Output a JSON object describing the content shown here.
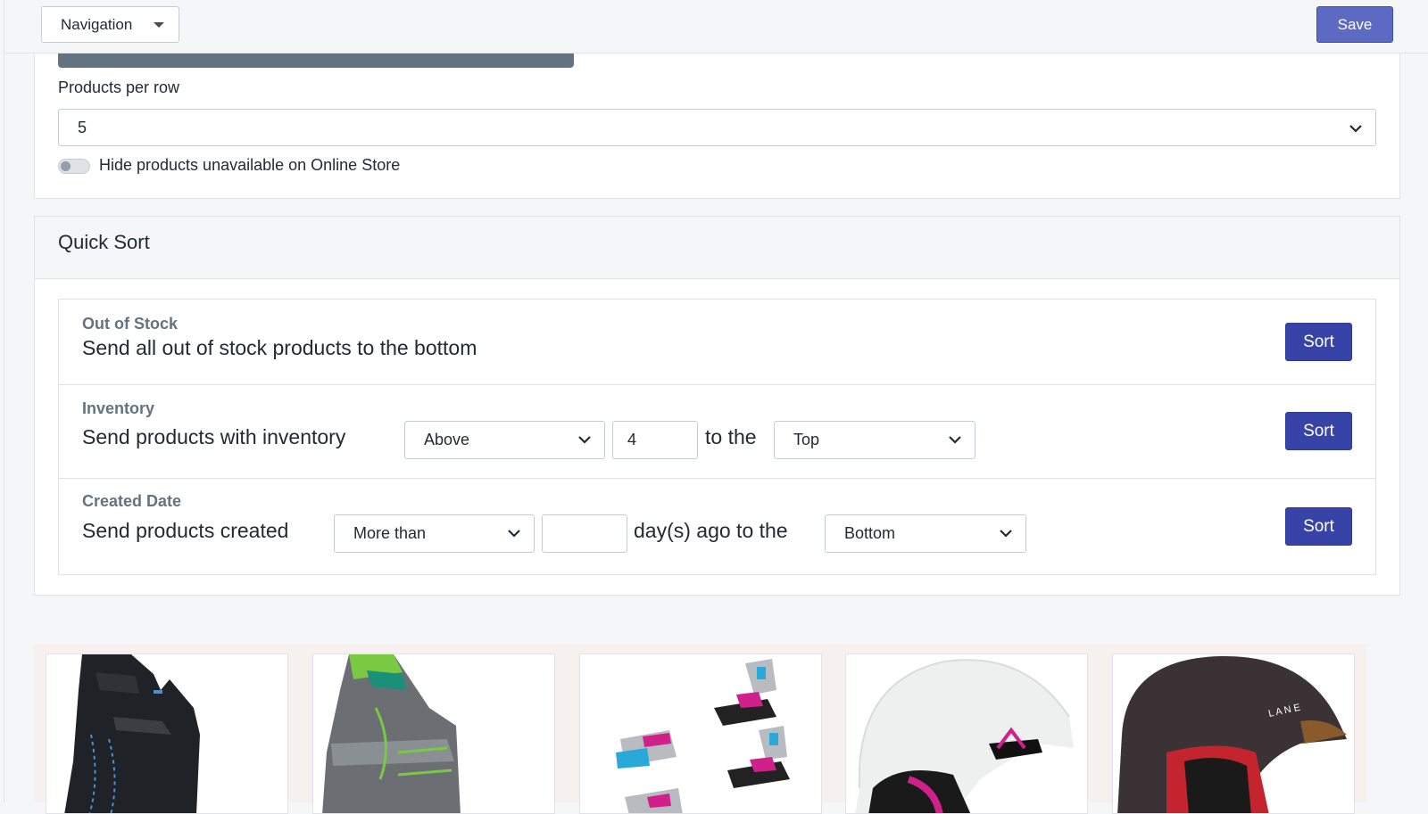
{
  "topbar": {
    "nav_label": "Navigation",
    "save_label": "Save"
  },
  "settings": {
    "products_per_row_label": "Products per row",
    "products_per_row_value": "5",
    "hide_unavailable_label": "Hide products unavailable on Online Store",
    "hide_unavailable_on": false
  },
  "quick_sort": {
    "title": "Quick Sort",
    "sort_label": "Sort",
    "rules": [
      {
        "title": "Out of Stock",
        "text": "Send all out of stock products to the bottom"
      },
      {
        "title": "Inventory",
        "text_before": "Send products with inventory",
        "comparison": "Above",
        "value": "4",
        "text_middle": "to the",
        "position": "Top"
      },
      {
        "title": "Created Date",
        "text_before": "Send products created",
        "comparison": "More than",
        "value": "",
        "text_middle": "day(s) ago to the",
        "position": "Bottom"
      }
    ]
  },
  "products": [
    {
      "icon": "black-snowboard-boot"
    },
    {
      "icon": "grey-green-snowboard-boot"
    },
    {
      "icon": "ski-bindings"
    },
    {
      "icon": "white-helmet"
    },
    {
      "icon": "brown-helmet"
    }
  ],
  "colors": {
    "primary": "#3843a8",
    "save": "#5c6ac4",
    "border": "#dfe3e8",
    "muted_text": "#637381"
  }
}
